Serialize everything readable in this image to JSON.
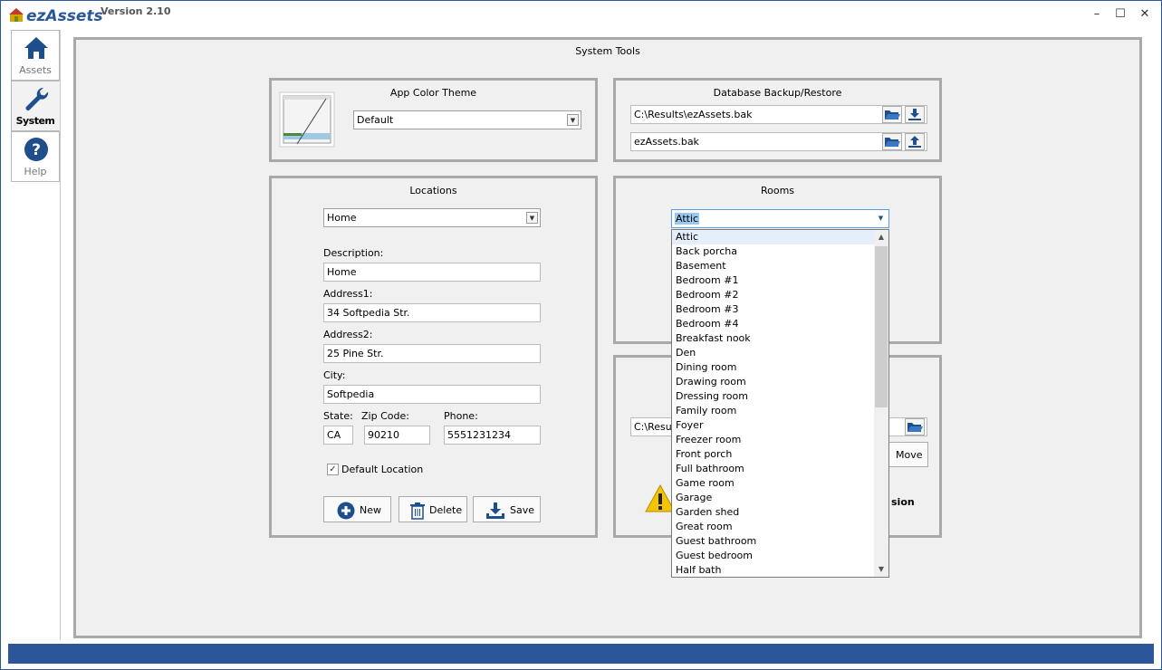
{
  "app": {
    "name": "ezAssets",
    "version": "Version  2.10"
  },
  "window_controls": {
    "minimize": "–",
    "maximize": "☐",
    "close": "✕"
  },
  "nav": {
    "items": [
      {
        "label": "Assets",
        "icon": "home-icon"
      },
      {
        "label": "System",
        "icon": "wrench-icon"
      },
      {
        "label": "Help",
        "icon": "help-icon"
      }
    ]
  },
  "page": {
    "title": "System Tools"
  },
  "color_theme": {
    "title": "App Color Theme",
    "selected": "Default"
  },
  "backup": {
    "title": "Database Backup/Restore",
    "backup_path": "C:\\Results\\ezAssets.bak",
    "restore_file": "ezAssets.bak"
  },
  "locations": {
    "title": "Locations",
    "selected": "Home",
    "description_label": "Description:",
    "description": "Home",
    "address1_label": "Address1:",
    "address1": "34 Softpedia Str.",
    "address2_label": "Address2:",
    "address2": "25 Pine Str.",
    "city_label": "City:",
    "city": "Softpedia",
    "state_label": "State:",
    "state": "CA",
    "zip_label": "Zip Code:",
    "zip": "90210",
    "phone_label": "Phone:",
    "phone": "5551231234",
    "default_label": "Default Location",
    "default_checked": true,
    "new_label": "New",
    "delete_label": "Delete",
    "save_label": "Save"
  },
  "rooms": {
    "title": "Rooms",
    "selected": "Attic",
    "options": [
      "Attic",
      "Back porcha",
      "Basement",
      "Bedroom #1",
      "Bedroom #2",
      "Bedroom #3",
      "Bedroom #4",
      "Breakfast nook",
      "Den",
      "Dining room",
      "Drawing room",
      "Dressing room",
      "Family room",
      "Foyer",
      "Freezer room",
      "Front porch",
      "Full bathroom",
      "Game room",
      "Garage",
      "Garden shed",
      "Great room",
      "Guest bathroom",
      "Guest bedroom",
      "Half bath"
    ]
  },
  "move_db": {
    "path_partial": "C:\\Result",
    "move_label": "Move",
    "warning_partial": "sion"
  },
  "colors": {
    "accent": "#2b579a",
    "panel_bg": "#f0f0f0",
    "border": "#a9a9a9"
  }
}
